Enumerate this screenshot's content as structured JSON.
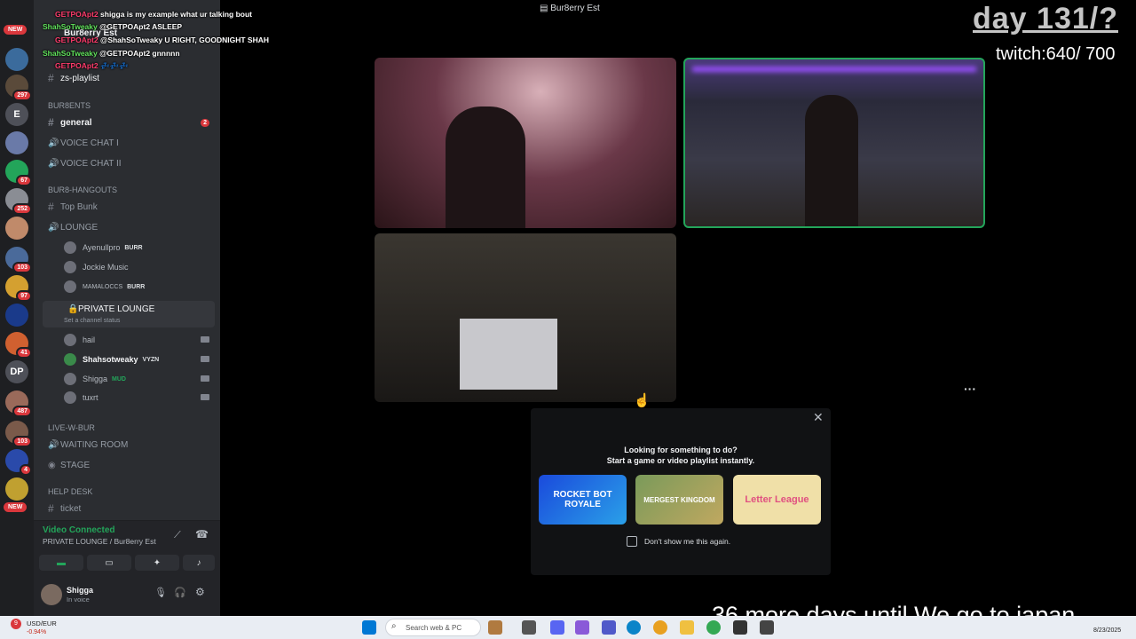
{
  "window": {
    "title": "Bur8erry Est"
  },
  "rail": {
    "new_label": "NEW",
    "badges": [
      "297",
      "67",
      "252",
      "103",
      "97",
      "41",
      "487",
      "103",
      "4"
    ],
    "letters": [
      "E",
      "DP"
    ]
  },
  "sidebar": {
    "server_name": "Bur8erry Est",
    "top_channel": "zs-playlist",
    "categories": [
      "BUR8ENTS",
      "BUR8-HANGOUTS",
      "LIVE-W-BUR",
      "HELP DESK"
    ],
    "channels": {
      "general": "general",
      "general_unread": "2",
      "voice1": "VOICE CHAT I",
      "voice2": "VOICE CHAT II",
      "top_bunk": "Top Bunk",
      "lounge": "LOUNGE",
      "private_lounge": "PRIVATE LOUNGE",
      "private_status": "Set a channel status",
      "waiting_room": "WAITING ROOM",
      "stage": "STAGE",
      "ticket": "ticket"
    },
    "lounge_users": [
      {
        "name": "Ayenullpro",
        "tag": "BURR"
      },
      {
        "name": "Jockie Music",
        "tag": ""
      },
      {
        "name": "MAMALOCCS",
        "tag": "BURR"
      }
    ],
    "private_users": [
      {
        "name": "hail",
        "tag": ""
      },
      {
        "name": "Shahsotweaky",
        "tag": "VYZN"
      },
      {
        "name": "Shigga",
        "tag": "MUD"
      },
      {
        "name": "tuxrt",
        "tag": ""
      }
    ]
  },
  "voice_panel": {
    "status": "Video Connected",
    "location": "PRIVATE LOUNGE / Bur8erry Est"
  },
  "user_panel": {
    "name": "Shigga",
    "status": "In voice"
  },
  "chat_overlay": [
    {
      "user": "GETPOApt2",
      "text": "shigga is my example what ur talking bout"
    },
    {
      "user": "ShahSoTweaky",
      "text": "@GETPOApt2 ASLEEP"
    },
    {
      "user": "GETPOApt2",
      "text": "@ShahSoTweaky U RIGHT, GOODNIGHT SHAH"
    },
    {
      "user": "ShahSoTweaky",
      "text": "@GETPOApt2 gnnnnn"
    },
    {
      "user": "GETPOApt2",
      "text": "💤💤💤"
    }
  ],
  "overlays": {
    "day": "day 131/?",
    "twitch": "twitch:640/ 700",
    "countdown": "36 more days until We go to japan"
  },
  "activity_modal": {
    "title": "Looking for something to do?",
    "subtitle": "Start a game or video playlist instantly.",
    "games": [
      "ROCKET BOT ROYALE",
      "MERGEST KINGDOM",
      "Letter League"
    ],
    "dont_show": "Don't show me this again."
  },
  "taskbar": {
    "ticker_name": "USD/EUR",
    "ticker_change": "-0.94%",
    "ticker_badge": "9",
    "search_placeholder": "Search web & PC",
    "date": "8/23/2025"
  },
  "colors": {
    "accent": "#23a55a",
    "danger": "#da373c",
    "blurple": "#5865f2"
  }
}
